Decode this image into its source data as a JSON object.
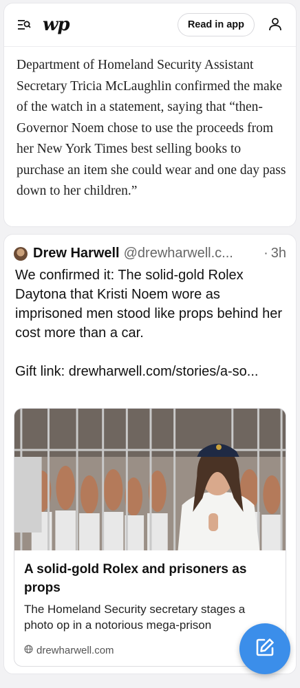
{
  "header": {
    "logo_text": "wp",
    "read_button_label": "Read in app",
    "menu_icon": "menu-search-icon",
    "user_icon": "user-icon"
  },
  "article": {
    "text": "Department of Homeland Security Assistant Secretary Tricia McLaughlin confirmed the make of the watch in a statement, saying that “then-Governor Noem chose to use the proceeds from her New York Times best selling books to purchase an item she could wear and one day pass down to her children.”"
  },
  "post": {
    "author": "Drew Harwell",
    "handle": "@drewharwell.c...",
    "dot": "·",
    "time": "3h",
    "text": "We confirmed it: The solid-gold Rolex Daytona that Kristi Noem wore as imprisoned men stood like props behind her cost more than a car.\n\nGift link: drewharwell.com/stories/a-so...",
    "link_card": {
      "title": "A solid-gold Rolex and prisoners as props",
      "description": "The Homeland Security secretary stages a photo op in a notorious mega-prison",
      "domain": "drewharwell.com"
    }
  },
  "fab": {
    "icon": "compose-icon"
  },
  "colors": {
    "accent": "#3b8eea",
    "card_border": "#e6e6ea",
    "page_bg": "#f2f2f4"
  }
}
